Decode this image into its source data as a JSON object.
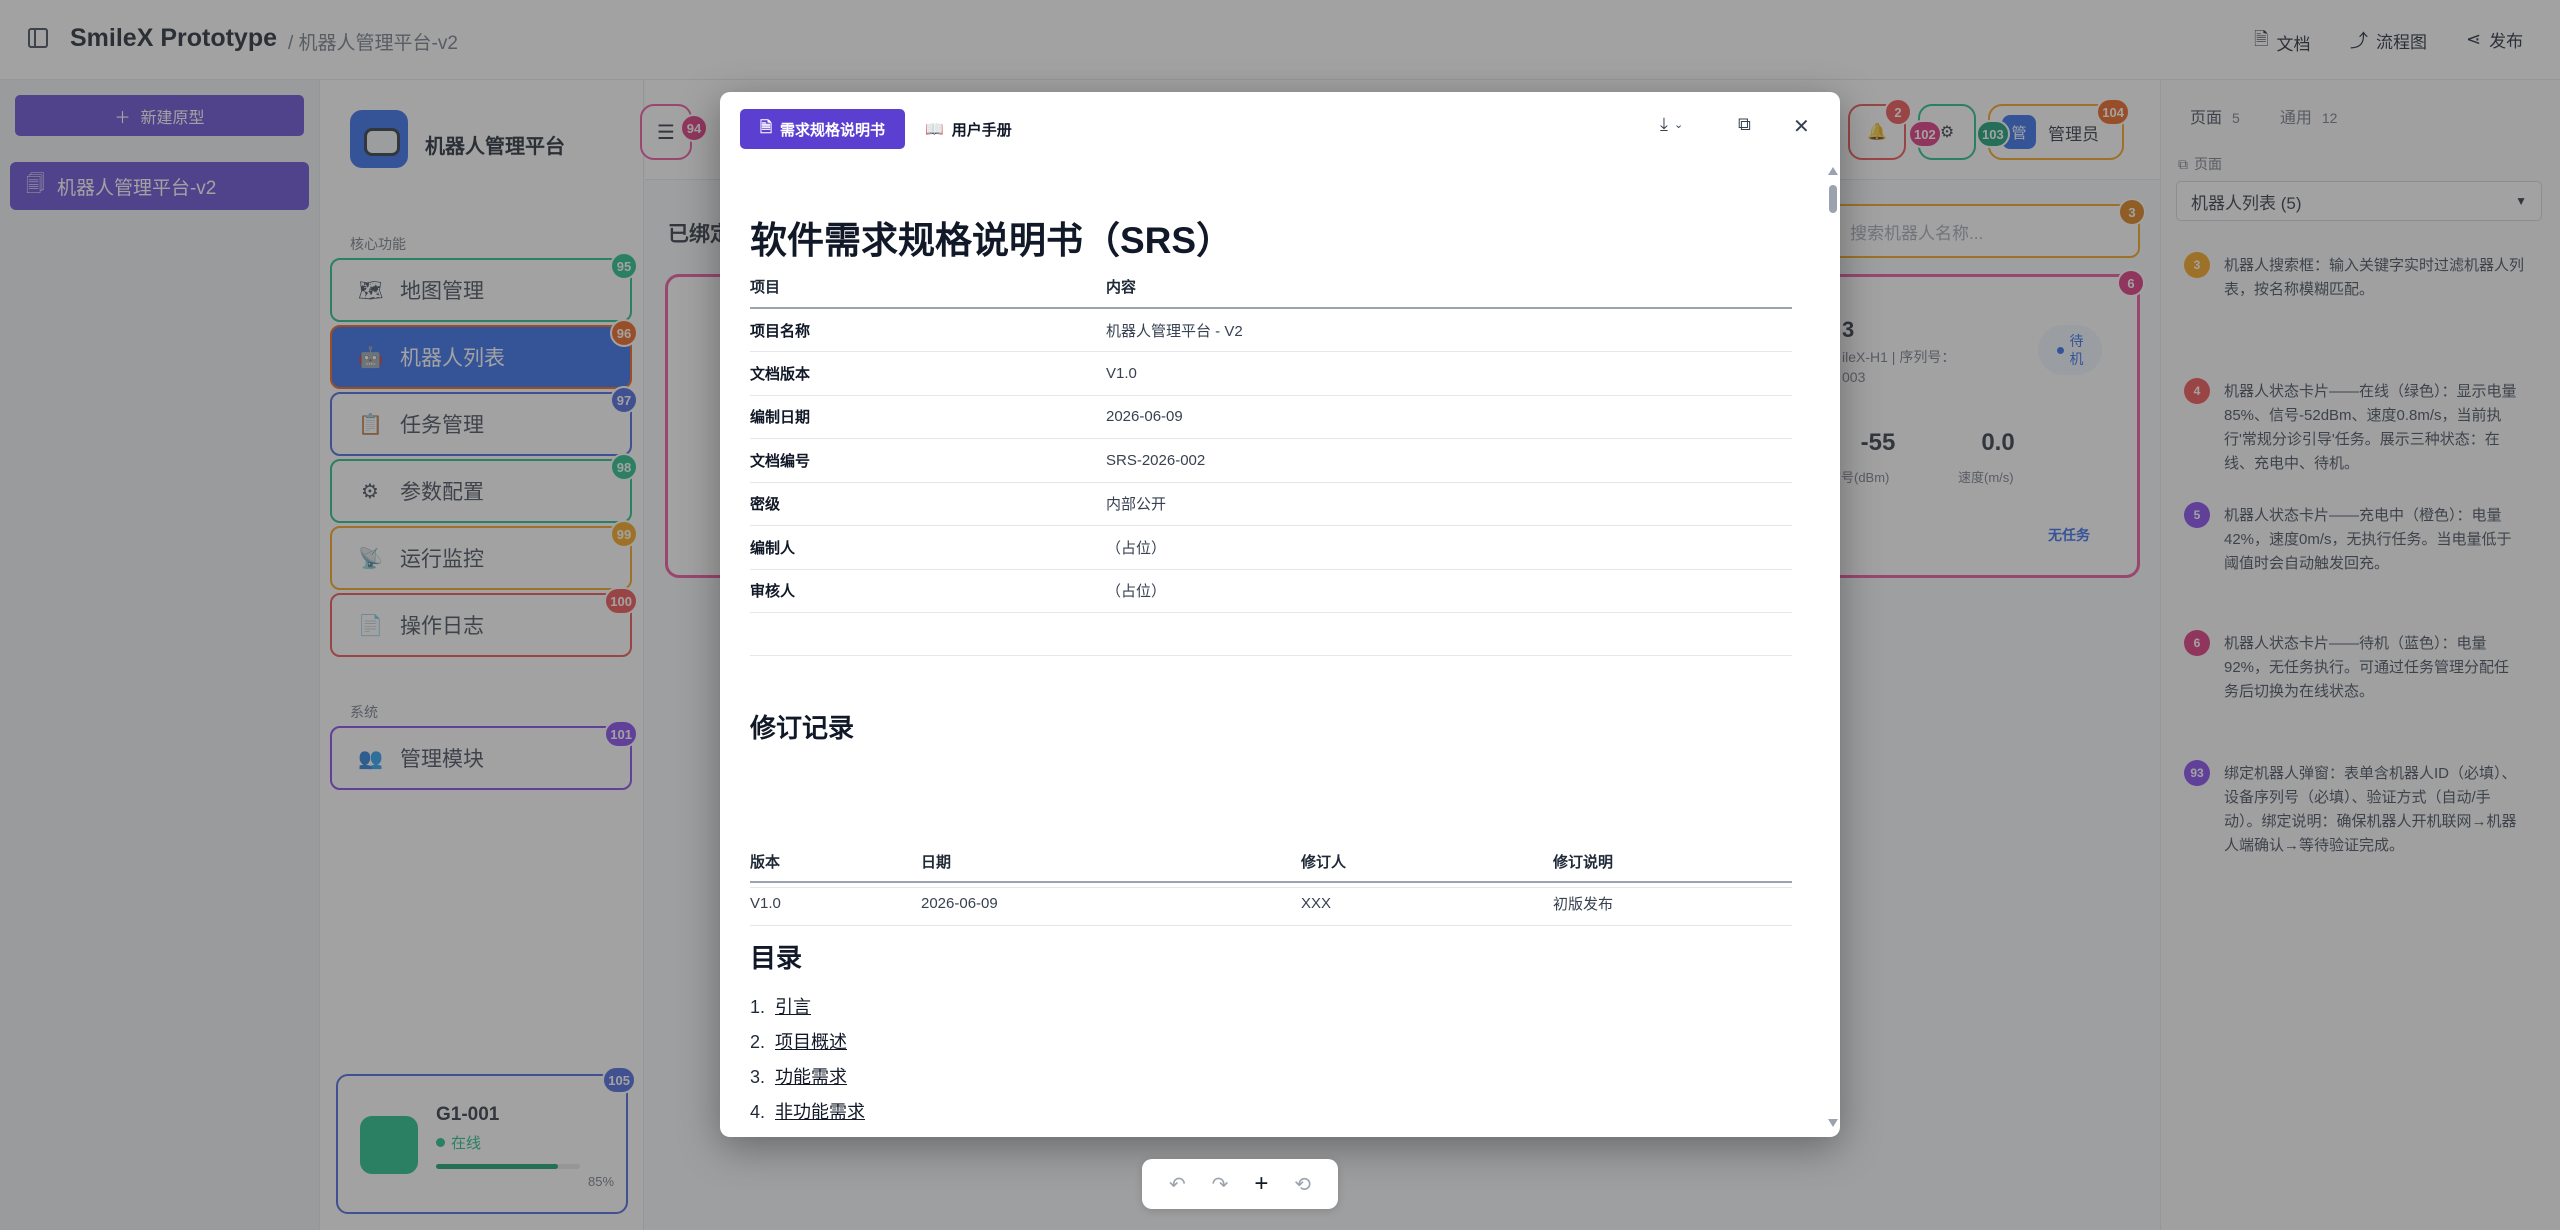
{
  "topbar": {
    "app_name": "SmileX Prototype",
    "breadcrumb": "/ 机器人管理平台-v2",
    "docs_label": "文档",
    "flow_label": "流程图",
    "publish_label": "发布"
  },
  "left_panel": {
    "new_button": "新建原型",
    "prototype_item": "机器人管理平台-v2"
  },
  "proto": {
    "brand": "机器人管理平台",
    "section_core": "核心功能",
    "section_system": "系统",
    "nav": [
      {
        "label": "地图管理",
        "badge": "95",
        "icon": "map-icon"
      },
      {
        "label": "机器人列表",
        "badge": "96",
        "icon": "robot-icon"
      },
      {
        "label": "任务管理",
        "badge": "97",
        "icon": "clipboard-icon"
      },
      {
        "label": "参数配置",
        "badge": "98",
        "icon": "gear-icon"
      },
      {
        "label": "运行监控",
        "badge": "99",
        "icon": "satellite-icon"
      },
      {
        "label": "操作日志",
        "badge": "100",
        "icon": "log-icon"
      }
    ],
    "system_nav": {
      "label": "管理模块",
      "badge": "101",
      "icon": "users-icon"
    },
    "robot_card": {
      "name": "G1-001",
      "status": "在线",
      "battery_pct": "85%",
      "battery": 0.85,
      "badge": "105"
    },
    "header": {
      "menu_badge": "94",
      "bell_badge": "2",
      "gear_badge": "102",
      "badge_103": "103",
      "admin_avatar": "管",
      "admin_label": "管理员",
      "admin_badge": "104"
    },
    "bound_label": "已绑定",
    "search_placeholder": "搜索机器人名称...",
    "search_badge": "3",
    "card_badge": "6",
    "card": {
      "id_suffix": "3",
      "meta_1": "ileX-H1 | 序列号：",
      "meta_2": "003",
      "status": "待机",
      "signal": "-55",
      "signal_label": "信号(dBm)",
      "speed": "0.0",
      "speed_label": "速度(m/s)",
      "task": "无任务"
    }
  },
  "right_panel": {
    "tab_pages": "页面",
    "tab_pages_count": "5",
    "tab_common": "通用",
    "tab_common_count": "12",
    "page_label": "页面",
    "select_value": "机器人列表 (5)",
    "notes": [
      {
        "n": "3",
        "color": "#f59e0b",
        "text": "机器人搜索框：输入关键字实时过滤机器人列表，按名称模糊匹配。"
      },
      {
        "n": "4",
        "color": "#ef4444",
        "text": "机器人状态卡片——在线（绿色）：显示电量85%、信号-52dBm、速度0.8m/s，当前执行'常规分诊引导'任务。展示三种状态：在线、充电中、待机。"
      },
      {
        "n": "5",
        "color": "#7c3aed",
        "text": "机器人状态卡片——充电中（橙色）：电量42%，速度0m/s，无执行任务。当电量低于阈值时会自动触发回充。"
      },
      {
        "n": "6",
        "color": "#db2777",
        "text": "机器人状态卡片——待机（蓝色）：电量92%，无任务执行。可通过任务管理分配任务后切换为在线状态。"
      },
      {
        "n": "93",
        "color": "#7c3aed",
        "text": "绑定机器人弹窗：表单含机器人ID（必填）、设备序列号（必填）、验证方式（自动/手动）。绑定说明：确保机器人开机联网→机器人端确认→等待验证完成。"
      }
    ]
  },
  "modal": {
    "tab_srs": "需求规格说明书",
    "tab_manual": "用户手册",
    "title": "软件需求规格说明书（SRS）",
    "info_header": [
      "项目",
      "内容"
    ],
    "info_rows": [
      [
        "项目名称",
        "机器人管理平台 - V2"
      ],
      [
        "文档版本",
        "V1.0"
      ],
      [
        "编制日期",
        "2026-06-09"
      ],
      [
        "文档编号",
        "SRS-2026-002"
      ],
      [
        "密级",
        "内部公开"
      ],
      [
        "编制人",
        "（占位）"
      ],
      [
        "审核人",
        "（占位）"
      ]
    ],
    "revision_title": "修订记录",
    "revision_header": [
      "版本",
      "日期",
      "修订人",
      "修订说明"
    ],
    "revision_rows": [
      [
        "V1.0",
        "2026-06-09",
        "XXX",
        "初版发布"
      ]
    ],
    "toc_title": "目录",
    "toc": [
      {
        "n": "1.",
        "label": "引言"
      },
      {
        "n": "2.",
        "label": "项目概述"
      },
      {
        "n": "3.",
        "label": "功能需求"
      },
      {
        "n": "4.",
        "label": "非功能需求"
      }
    ]
  },
  "colors": {
    "brand": "#5b3fd1",
    "nav_border_1": "#10b981",
    "nav_active": "#2563eb",
    "nav_border_3": "#3b5bdb",
    "nav_border_4": "#10b981",
    "nav_border_5": "#f59e0b",
    "nav_border_6": "#ef4444",
    "nav_border_sys": "#7c3aed"
  }
}
